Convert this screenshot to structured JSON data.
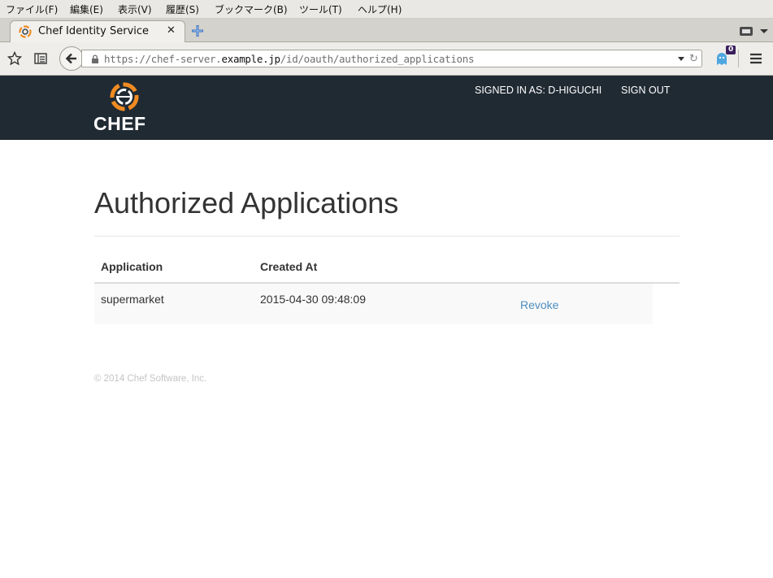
{
  "menubar": {
    "items": [
      "ファイル(F)",
      "編集(E)",
      "表示(V)",
      "履歴(S)",
      "ブックマーク(B)",
      "ツール(T)",
      "ヘルプ(H)"
    ]
  },
  "browser": {
    "tab_title": "Chef Identity Service",
    "url_prefix": "https://chef-server.",
    "url_host": "example.jp",
    "url_path": "/id/oauth/authorized_applications",
    "addon_badge": "0"
  },
  "header": {
    "logo_text": "CHEF",
    "signed_in": "SIGNED IN AS: D-HIGUCHI",
    "sign_out": "SIGN OUT",
    "background": "#202a33",
    "accent": "#f18b21"
  },
  "main": {
    "title": "Authorized Applications",
    "table": {
      "columns": [
        "Application",
        "Created At"
      ],
      "rows": [
        {
          "application": "supermarket",
          "created_at": "2015-04-30 09:48:09",
          "action": "Revoke"
        }
      ]
    }
  },
  "footer": {
    "copyright": "© 2014 Chef Software, Inc."
  }
}
